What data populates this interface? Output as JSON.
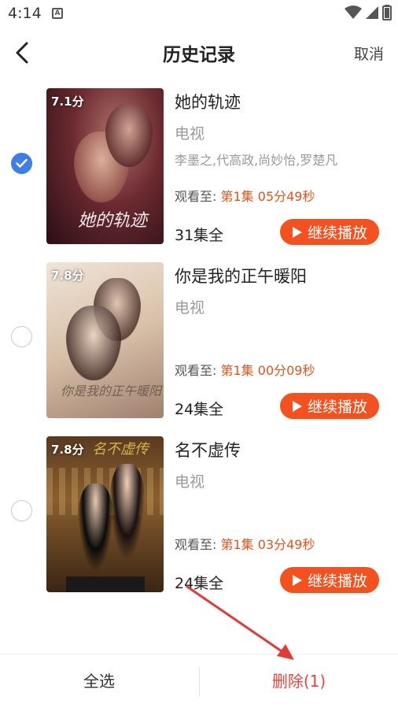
{
  "status": {
    "time": "4:14",
    "notification_badge": "A"
  },
  "header": {
    "title": "历史记录",
    "cancel": "取消"
  },
  "items": [
    {
      "rating": "7.1分",
      "poster_text": "她的轨迹",
      "title": "她的轨迹",
      "type": "电视",
      "cast": "李墨之,代高政,尚妙怡,罗楚凡",
      "progress_label": "观看至:",
      "progress_value": "第1集 05分49秒",
      "episodes": "31集全",
      "play_label": "继续播放",
      "checked": true
    },
    {
      "rating": "7.8分",
      "poster_text": "你是我的正午暖阳",
      "title": "你是我的正午暖阳",
      "type": "电视",
      "cast": "",
      "progress_label": "观看至:",
      "progress_value": "第1集 00分09秒",
      "episodes": "24集全",
      "play_label": "继续播放",
      "checked": false
    },
    {
      "rating": "7.8分",
      "poster_text": "名不虚传",
      "title": "名不虚传",
      "type": "电视",
      "cast": "",
      "progress_label": "观看至:",
      "progress_value": "第1集 03分49秒",
      "episodes": "24集全",
      "play_label": "继续播放",
      "checked": false
    }
  ],
  "footer": {
    "select_all": "全选",
    "delete": "删除(1)"
  },
  "colors": {
    "accent": "#f4511e",
    "check": "#3f7de8",
    "delete": "#e8453c",
    "arrow": "#e53935"
  }
}
